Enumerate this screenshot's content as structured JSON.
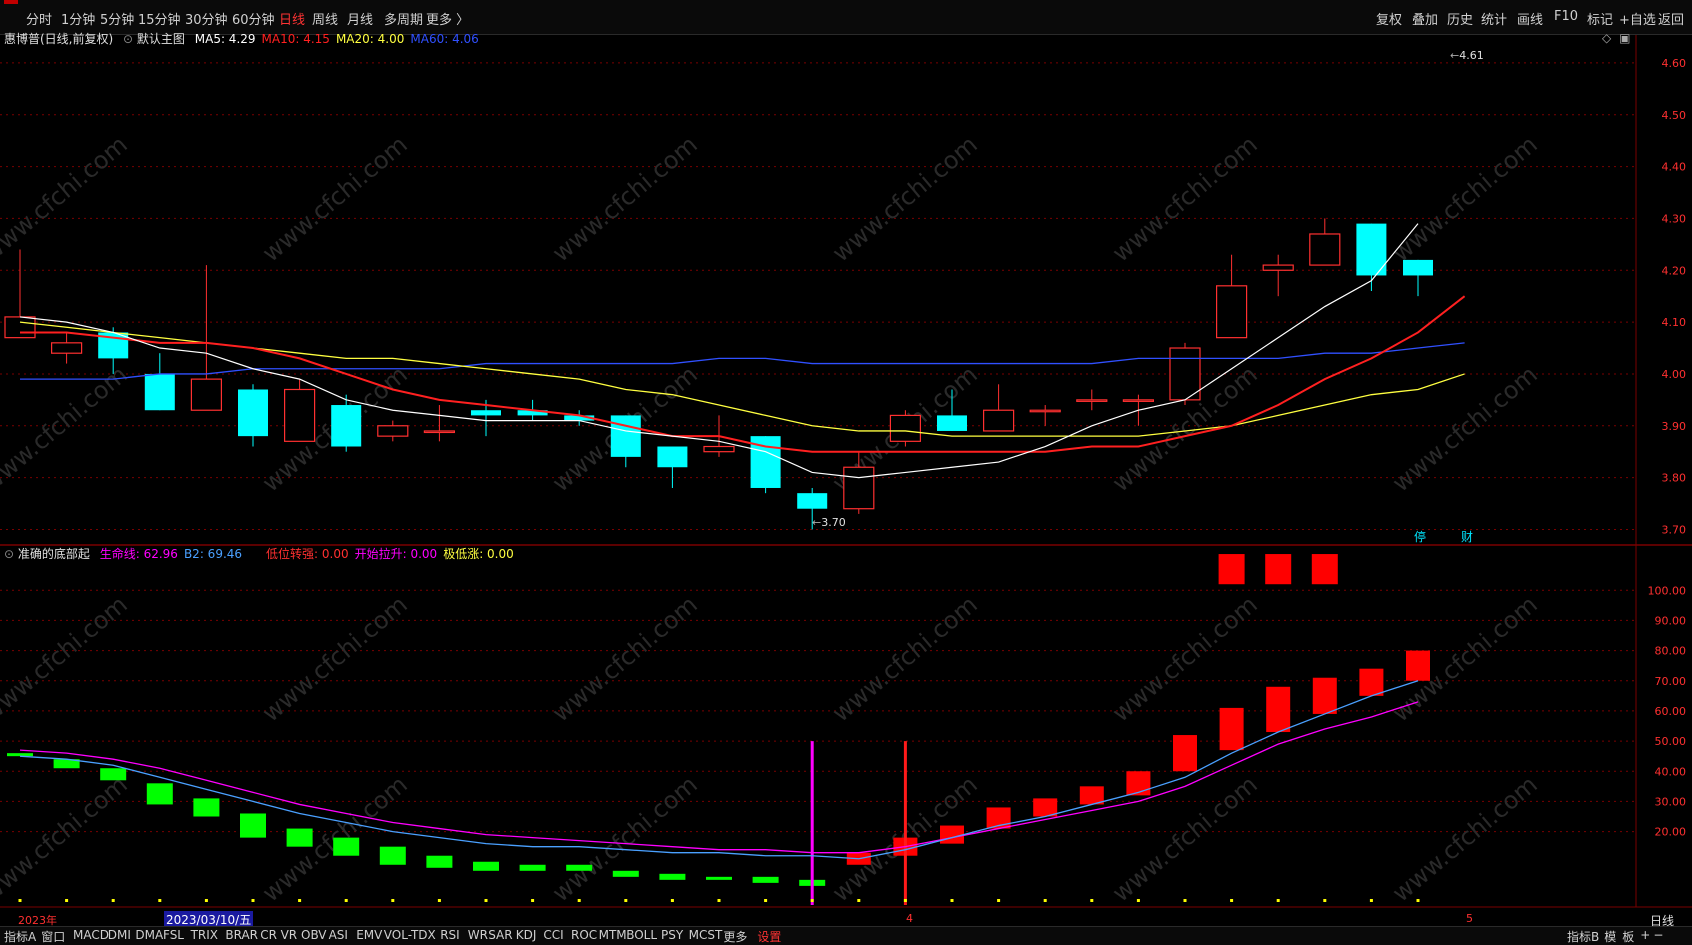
{
  "toolbar": {
    "periods": [
      "分时",
      "1分钟",
      "5分钟",
      "15分钟",
      "30分钟",
      "60分钟",
      "日线",
      "周线",
      "月线",
      "多周期",
      "更多 〉"
    ],
    "active_period": "日线",
    "right_tools": [
      "复权",
      "叠加",
      "历史",
      "统计",
      "画线",
      "F10",
      "标记",
      "+自选",
      "返回"
    ]
  },
  "main_panel": {
    "stock_title": "惠博普(日线,前复权)",
    "template": "默认主图",
    "ma_labels": [
      {
        "text": "MA5: 4.29",
        "color": "#ffffff"
      },
      {
        "text": "MA10: 4.15",
        "color": "#ff2020"
      },
      {
        "text": "MA20: 4.00",
        "color": "#ffff40"
      },
      {
        "text": "MA60: 4.06",
        "color": "#3050ff"
      }
    ],
    "high_marker": "4.61",
    "low_marker": "3.70",
    "event_tags": [
      "停",
      "财"
    ]
  },
  "sub_panel": {
    "indicator_name": "准确的底部起",
    "labels": [
      {
        "text": "生命线: 62.96",
        "color": "#ff00ff"
      },
      {
        "text": "B2: 69.46",
        "color": "#4aa0ff"
      },
      {
        "text": "低位转强: 0.00",
        "color": "#ff3030"
      },
      {
        "text": "开始拉升: 0.00",
        "color": "#ff00ff"
      },
      {
        "text": "极低涨: 0.00",
        "color": "#ffff40"
      }
    ]
  },
  "time_axis": {
    "year_label": "2023年",
    "date_cursor": "2023/03/10/五",
    "month_4": "4",
    "month_5": "5",
    "period": "日线"
  },
  "bottom_tabs": {
    "left": [
      "指标A",
      "窗口"
    ],
    "indicators": [
      "MACD",
      "DMI",
      "DMA",
      "FSL",
      "TRIX",
      "BRAR",
      "CR",
      "VR",
      "OBV",
      "ASI",
      "EMV",
      "VOL-TDX",
      "RSI",
      "WR",
      "SAR",
      "KDJ",
      "CCI",
      "ROC",
      "MTM",
      "BOLL",
      "PSY",
      "MCST",
      "更多"
    ],
    "settings": "设置",
    "right": [
      "指标B",
      "模",
      "板",
      "+",
      "−"
    ]
  },
  "watermark": "www.cfchi.com",
  "colors": {
    "up": "#ff3030",
    "down": "#00ffff",
    "grid": "#7a0000",
    "ma5": "#ffffff",
    "ma10": "#ff2020",
    "ma20": "#ffff40",
    "ma60": "#3050ff"
  },
  "chart_data": [
    {
      "type": "candlestick",
      "title": "惠博普(日线,前复权)",
      "y_ticks": [
        3.7,
        3.8,
        3.9,
        4.0,
        4.1,
        4.2,
        4.3,
        4.4,
        4.5,
        4.6
      ],
      "ylim": [
        3.67,
        4.65
      ],
      "candles": [
        {
          "o": 4.07,
          "h": 4.24,
          "l": 4.07,
          "c": 4.11
        },
        {
          "o": 4.04,
          "h": 4.08,
          "l": 4.02,
          "c": 4.06
        },
        {
          "o": 4.08,
          "h": 4.09,
          "l": 4.0,
          "c": 4.03
        },
        {
          "o": 4.0,
          "h": 4.04,
          "l": 3.93,
          "c": 3.93
        },
        {
          "o": 3.93,
          "h": 4.21,
          "l": 3.93,
          "c": 3.99
        },
        {
          "o": 3.97,
          "h": 3.98,
          "l": 3.86,
          "c": 3.88
        },
        {
          "o": 3.87,
          "h": 3.99,
          "l": 3.87,
          "c": 3.97
        },
        {
          "o": 3.94,
          "h": 3.96,
          "l": 3.85,
          "c": 3.86
        },
        {
          "o": 3.88,
          "h": 3.91,
          "l": 3.87,
          "c": 3.9
        },
        {
          "o": 3.89,
          "h": 3.94,
          "l": 3.87,
          "c": 3.89
        },
        {
          "o": 3.93,
          "h": 3.95,
          "l": 3.88,
          "c": 3.92
        },
        {
          "o": 3.93,
          "h": 3.95,
          "l": 3.91,
          "c": 3.92
        },
        {
          "o": 3.92,
          "h": 3.93,
          "l": 3.9,
          "c": 3.91
        },
        {
          "o": 3.92,
          "h": 3.92,
          "l": 3.82,
          "c": 3.84
        },
        {
          "o": 3.86,
          "h": 3.86,
          "l": 3.78,
          "c": 3.82
        },
        {
          "o": 3.85,
          "h": 3.92,
          "l": 3.84,
          "c": 3.86
        },
        {
          "o": 3.88,
          "h": 3.88,
          "l": 3.77,
          "c": 3.78
        },
        {
          "o": 3.77,
          "h": 3.78,
          "l": 3.7,
          "c": 3.74
        },
        {
          "o": 3.74,
          "h": 3.85,
          "l": 3.73,
          "c": 3.82
        },
        {
          "o": 3.87,
          "h": 3.93,
          "l": 3.86,
          "c": 3.92
        },
        {
          "o": 3.92,
          "h": 3.97,
          "l": 3.89,
          "c": 3.89
        },
        {
          "o": 3.89,
          "h": 3.98,
          "l": 3.89,
          "c": 3.93
        },
        {
          "o": 3.93,
          "h": 3.94,
          "l": 3.9,
          "c": 3.93
        },
        {
          "o": 3.95,
          "h": 3.97,
          "l": 3.93,
          "c": 3.95
        },
        {
          "o": 3.95,
          "h": 3.96,
          "l": 3.9,
          "c": 3.95
        },
        {
          "o": 3.95,
          "h": 4.06,
          "l": 3.94,
          "c": 4.05
        },
        {
          "o": 4.07,
          "h": 4.23,
          "l": 4.07,
          "c": 4.17
        },
        {
          "o": 4.2,
          "h": 4.23,
          "l": 4.15,
          "c": 4.21
        },
        {
          "o": 4.21,
          "h": 4.3,
          "l": 4.21,
          "c": 4.27
        },
        {
          "o": 4.29,
          "h": 4.29,
          "l": 4.16,
          "c": 4.19
        },
        {
          "o": 4.22,
          "h": 4.22,
          "l": 4.15,
          "c": 4.19
        }
      ],
      "ma5": [
        4.11,
        4.1,
        4.08,
        4.05,
        4.04,
        4.01,
        3.99,
        3.95,
        3.93,
        3.92,
        3.91,
        3.91,
        3.91,
        3.89,
        3.88,
        3.87,
        3.85,
        3.81,
        3.8,
        3.81,
        3.82,
        3.83,
        3.86,
        3.9,
        3.93,
        3.95,
        4.01,
        4.07,
        4.13,
        4.18,
        4.29
      ],
      "ma10": [
        4.08,
        4.08,
        4.07,
        4.06,
        4.06,
        4.05,
        4.03,
        4.0,
        3.97,
        3.95,
        3.94,
        3.93,
        3.92,
        3.9,
        3.88,
        3.88,
        3.86,
        3.85,
        3.85,
        3.85,
        3.85,
        3.85,
        3.85,
        3.86,
        3.86,
        3.88,
        3.9,
        3.94,
        3.99,
        4.03,
        4.08,
        4.15
      ],
      "ma20": [
        4.1,
        4.09,
        4.08,
        4.07,
        4.06,
        4.05,
        4.04,
        4.03,
        4.03,
        4.02,
        4.01,
        4.0,
        3.99,
        3.97,
        3.96,
        3.94,
        3.92,
        3.9,
        3.89,
        3.89,
        3.88,
        3.88,
        3.88,
        3.88,
        3.88,
        3.89,
        3.9,
        3.92,
        3.94,
        3.96,
        3.97,
        4.0
      ],
      "ma60": [
        3.99,
        3.99,
        3.99,
        4.0,
        4.0,
        4.01,
        4.01,
        4.01,
        4.01,
        4.01,
        4.02,
        4.02,
        4.02,
        4.02,
        4.02,
        4.03,
        4.03,
        4.02,
        4.02,
        4.02,
        4.02,
        4.02,
        4.02,
        4.02,
        4.03,
        4.03,
        4.03,
        4.03,
        4.04,
        4.04,
        4.05,
        4.06
      ]
    },
    {
      "type": "bar",
      "title": "准确的底部起",
      "y_ticks": [
        20,
        30,
        40,
        50,
        60,
        70,
        80,
        90,
        100
      ],
      "ylim": [
        -5,
        115
      ],
      "bars": [
        {
          "lo": 45,
          "hi": 46,
          "up": false
        },
        {
          "lo": 41,
          "hi": 44,
          "up": false
        },
        {
          "lo": 37,
          "hi": 41,
          "up": false
        },
        {
          "lo": 29,
          "hi": 36,
          "up": false
        },
        {
          "lo": 25,
          "hi": 31,
          "up": false
        },
        {
          "lo": 18,
          "hi": 26,
          "up": false
        },
        {
          "lo": 15,
          "hi": 21,
          "up": false
        },
        {
          "lo": 12,
          "hi": 18,
          "up": false
        },
        {
          "lo": 9,
          "hi": 15,
          "up": false
        },
        {
          "lo": 8,
          "hi": 12,
          "up": false
        },
        {
          "lo": 7,
          "hi": 10,
          "up": false
        },
        {
          "lo": 7,
          "hi": 9,
          "up": false
        },
        {
          "lo": 7,
          "hi": 9,
          "up": false
        },
        {
          "lo": 5,
          "hi": 7,
          "up": false
        },
        {
          "lo": 4,
          "hi": 6,
          "up": false
        },
        {
          "lo": 4,
          "hi": 5,
          "up": false
        },
        {
          "lo": 3,
          "hi": 5,
          "up": false
        },
        {
          "lo": 2,
          "hi": 4,
          "up": false
        },
        {
          "lo": 9,
          "hi": 13,
          "up": true
        },
        {
          "lo": 12,
          "hi": 18,
          "up": true
        },
        {
          "lo": 16,
          "hi": 22,
          "up": true
        },
        {
          "lo": 21,
          "hi": 28,
          "up": true
        },
        {
          "lo": 25,
          "hi": 31,
          "up": true
        },
        {
          "lo": 29,
          "hi": 35,
          "up": true
        },
        {
          "lo": 32,
          "hi": 40,
          "up": true
        },
        {
          "lo": 40,
          "hi": 52,
          "up": true
        },
        {
          "lo": 47,
          "hi": 61,
          "up": true
        },
        {
          "lo": 53,
          "hi": 68,
          "up": true
        },
        {
          "lo": 59,
          "hi": 71,
          "up": true
        },
        {
          "lo": 65,
          "hi": 74,
          "up": true
        },
        {
          "lo": 70,
          "hi": 80,
          "up": true
        }
      ],
      "top_blocks": [
        26,
        27,
        28
      ],
      "shengming": [
        47,
        46,
        44,
        41,
        37,
        33,
        29,
        26,
        23,
        21,
        19,
        18,
        17,
        16,
        15,
        14,
        14,
        13,
        13,
        15,
        18,
        21,
        24,
        27,
        30,
        35,
        42,
        49,
        54,
        58,
        63
      ],
      "b2": [
        45,
        44,
        42,
        38,
        34,
        30,
        26,
        23,
        20,
        18,
        16,
        15,
        15,
        14,
        13,
        13,
        12,
        12,
        11,
        14,
        18,
        22,
        25,
        29,
        33,
        38,
        46,
        53,
        59,
        65,
        70
      ],
      "spikes": [
        {
          "index": 17,
          "value": 50,
          "color": "#ff00ff"
        },
        {
          "index": 19,
          "value": 50,
          "color": "#ff1a1a"
        }
      ]
    }
  ]
}
